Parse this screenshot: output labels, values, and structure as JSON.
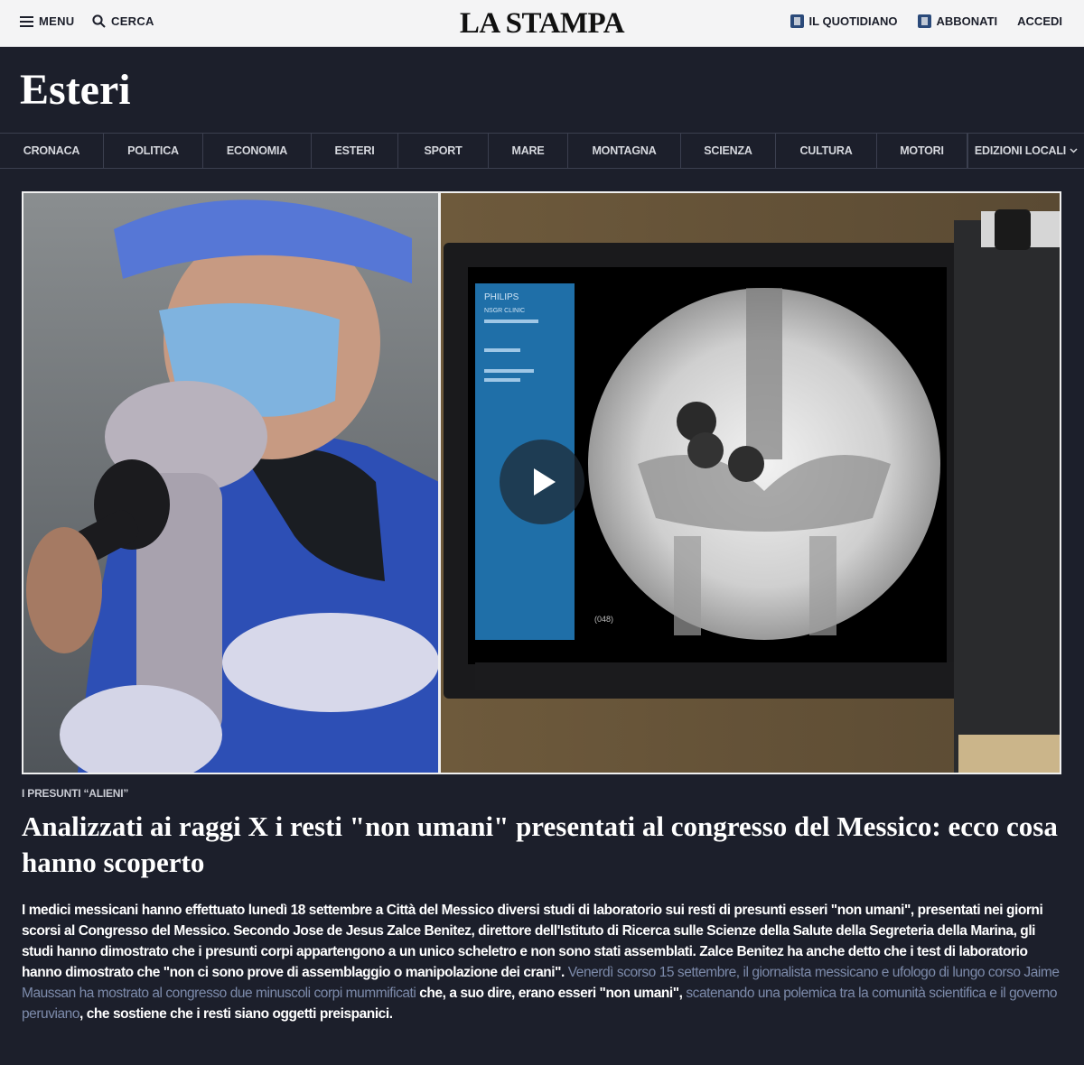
{
  "header": {
    "menu_label": "MENU",
    "search_label": "CERCA",
    "logo": "LA STAMPA",
    "quotidiano_label": "IL QUOTIDIANO",
    "abbonati_label": "ABBONATI",
    "accedi_label": "ACCEDI"
  },
  "section": {
    "title": "Esteri"
  },
  "nav": {
    "items": [
      "CRONACA",
      "POLITICA",
      "ECONOMIA",
      "ESTERI",
      "SPORT",
      "MARE",
      "MONTAGNA",
      "SCIENZA",
      "CULTURA",
      "MOTORI"
    ],
    "editions": "EDIZIONI LOCALI"
  },
  "article": {
    "kicker": "I PRESUNTI “ALIENI”",
    "headline": "Analizzati ai raggi X i resti \"non umani\" presentati al congresso del Messico: ecco cosa hanno scoperto",
    "p1": "I medici messicani hanno effettuato lunedì 18 settembre a Città del Messico diversi studi di laboratorio sui resti di presunti esseri \"non umani\", presentati nei giorni scorsi al Congresso del Messico. Secondo Jose de Jesus Zalce Benitez, direttore dell'Istituto di Ricerca sulle Scienze della Salute della Segreteria della Marina, gli studi hanno dimostrato che i presunti corpi appartengono a un unico scheletro e non sono stati assemblati. Zalce Benitez ha anche detto che i test di laboratorio hanno dimostrato che \"non ci sono prove di assemblaggio o manipolazione dei crani\".",
    "link1": "Venerdì scorso 15 settembre, il giornalista messicano e ufologo di lungo corso Jaime Maussan ha mostrato al congresso due minuscoli corpi mummificati",
    "p2": "che, a suo dire, erano esseri \"non umani\",",
    "link2": "scatenando una polemica tra la comunità scientifica e il governo peruviano",
    "p3": ", che sostiene che i resti siano oggetti preispanici."
  },
  "video": {
    "screen_brand": "PHILIPS",
    "screen_clinic": "NSGR CLINIC",
    "screen_code": "(048)"
  },
  "colors": {
    "background": "#1c1f2b",
    "topbar": "#f4f4f5",
    "link": "#7d8bab"
  }
}
